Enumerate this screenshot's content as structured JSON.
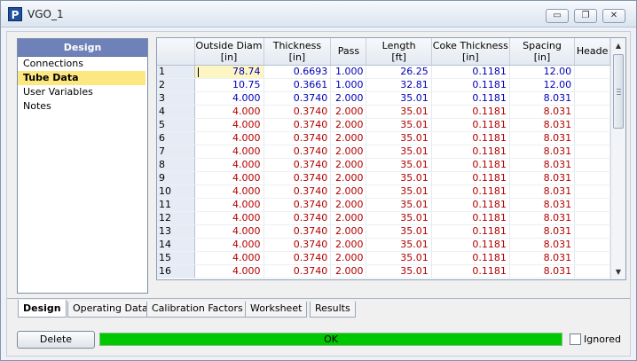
{
  "window": {
    "app_icon_letter": "P",
    "title": "VGO_1",
    "minimize_glyph": "▭",
    "restore_glyph": "❐",
    "close_glyph": "✕"
  },
  "nav": {
    "header": "Design",
    "items": [
      "Connections",
      "Tube Data",
      "User Variables",
      "Notes"
    ],
    "selected_index": 1
  },
  "grid": {
    "columns": [
      {
        "name": "Outside Diam",
        "unit": "[in]"
      },
      {
        "name": "Thickness",
        "unit": "[in]"
      },
      {
        "name": "Pass",
        "unit": ""
      },
      {
        "name": "Length",
        "unit": "[ft]"
      },
      {
        "name": "Coke Thickness",
        "unit": "[in]"
      },
      {
        "name": "Spacing",
        "unit": "[in]"
      },
      {
        "name": "Heade",
        "unit": ""
      }
    ],
    "rows": [
      {
        "n": "1",
        "c": "blue",
        "v": [
          "78.74",
          "0.6693",
          "1.000",
          "26.25",
          "0.1181",
          "12.00"
        ]
      },
      {
        "n": "2",
        "c": "blue",
        "v": [
          "10.75",
          "0.3661",
          "1.000",
          "32.81",
          "0.1181",
          "12.00"
        ]
      },
      {
        "n": "3",
        "c": "blue",
        "v": [
          "4.000",
          "0.3740",
          "2.000",
          "35.01",
          "0.1181",
          "8.031"
        ]
      },
      {
        "n": "4",
        "c": "red",
        "v": [
          "4.000",
          "0.3740",
          "2.000",
          "35.01",
          "0.1181",
          "8.031"
        ]
      },
      {
        "n": "5",
        "c": "red",
        "v": [
          "4.000",
          "0.3740",
          "2.000",
          "35.01",
          "0.1181",
          "8.031"
        ]
      },
      {
        "n": "6",
        "c": "red",
        "v": [
          "4.000",
          "0.3740",
          "2.000",
          "35.01",
          "0.1181",
          "8.031"
        ]
      },
      {
        "n": "7",
        "c": "red",
        "v": [
          "4.000",
          "0.3740",
          "2.000",
          "35.01",
          "0.1181",
          "8.031"
        ]
      },
      {
        "n": "8",
        "c": "red",
        "v": [
          "4.000",
          "0.3740",
          "2.000",
          "35.01",
          "0.1181",
          "8.031"
        ]
      },
      {
        "n": "9",
        "c": "red",
        "v": [
          "4.000",
          "0.3740",
          "2.000",
          "35.01",
          "0.1181",
          "8.031"
        ]
      },
      {
        "n": "10",
        "c": "red",
        "v": [
          "4.000",
          "0.3740",
          "2.000",
          "35.01",
          "0.1181",
          "8.031"
        ]
      },
      {
        "n": "11",
        "c": "red",
        "v": [
          "4.000",
          "0.3740",
          "2.000",
          "35.01",
          "0.1181",
          "8.031"
        ]
      },
      {
        "n": "12",
        "c": "red",
        "v": [
          "4.000",
          "0.3740",
          "2.000",
          "35.01",
          "0.1181",
          "8.031"
        ]
      },
      {
        "n": "13",
        "c": "red",
        "v": [
          "4.000",
          "0.3740",
          "2.000",
          "35.01",
          "0.1181",
          "8.031"
        ]
      },
      {
        "n": "14",
        "c": "red",
        "v": [
          "4.000",
          "0.3740",
          "2.000",
          "35.01",
          "0.1181",
          "8.031"
        ]
      },
      {
        "n": "15",
        "c": "red",
        "v": [
          "4.000",
          "0.3740",
          "2.000",
          "35.01",
          "0.1181",
          "8.031"
        ]
      },
      {
        "n": "16",
        "c": "red",
        "v": [
          "4.000",
          "0.3740",
          "2.000",
          "35.01",
          "0.1181",
          "8.031"
        ]
      }
    ],
    "colors": {
      "red": "#b00000",
      "blue": "#0000b8"
    },
    "scroll_up_glyph": "▲",
    "scroll_down_glyph": "▼"
  },
  "tabs": [
    "Design",
    "Operating Data",
    "Calibration Factors",
    "Worksheet",
    "Results"
  ],
  "active_tab": 0,
  "footer": {
    "delete_label": "Delete",
    "status_text": "OK",
    "status_color": "#00c800",
    "ignored_label": "Ignored",
    "ignored_checked": false
  }
}
